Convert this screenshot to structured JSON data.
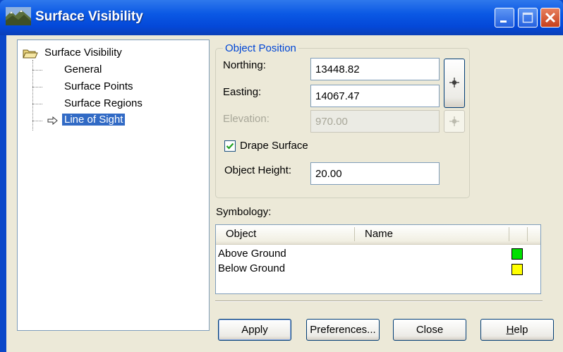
{
  "window": {
    "title": "Surface Visibility"
  },
  "tree": {
    "root": "Surface Visibility",
    "items": [
      "General",
      "Surface Points",
      "Surface Regions",
      "Line of Sight"
    ],
    "selected": "Line of Sight"
  },
  "object_position": {
    "group_label": "Object Position",
    "northing_label": "Northing:",
    "northing_value": "13448.82",
    "easting_label": "Easting:",
    "easting_value": "14067.47",
    "elevation_label": "Elevation:",
    "elevation_value": "970.00",
    "drape_label": "Drape Surface",
    "drape_checked": true,
    "height_label": "Object Height:",
    "height_value": "20.00"
  },
  "symbology": {
    "label": "Symbology:",
    "columns": [
      "Object",
      "Name"
    ],
    "rows": [
      {
        "object": "Above Ground",
        "name": "",
        "color": "#00e000"
      },
      {
        "object": "Below Ground",
        "name": "",
        "color": "#ffff00"
      }
    ]
  },
  "buttons": {
    "apply": "Apply",
    "preferences": "Preferences...",
    "close": "Close",
    "help_h": "H",
    "help_rest": "elp"
  }
}
